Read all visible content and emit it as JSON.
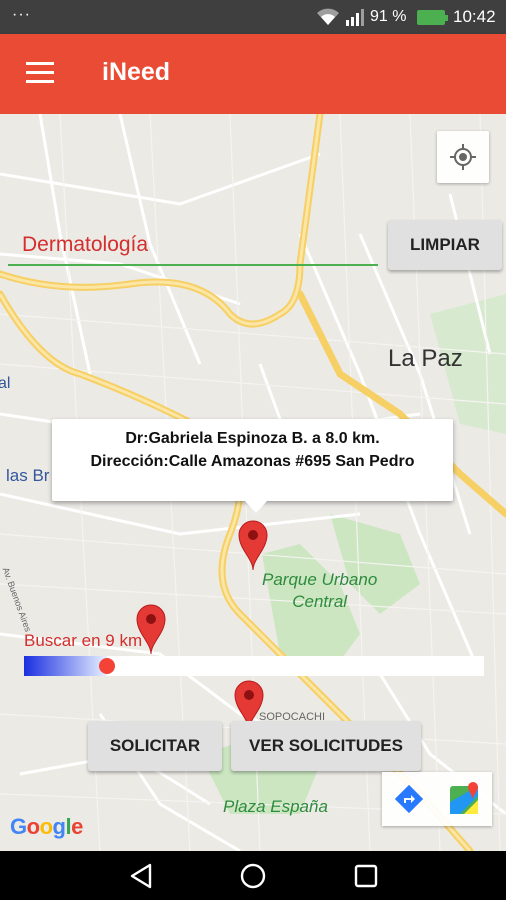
{
  "status_bar": {
    "dots": "···",
    "battery_percent": "91 %",
    "time": "10:42",
    "icons": [
      "wifi-icon",
      "signal-icon",
      "battery-charging-icon"
    ]
  },
  "app_bar": {
    "title": "iNeed",
    "background": "#e94b35",
    "menu_icon": "hamburger-menu-icon"
  },
  "search": {
    "value": "Dermatología",
    "clear_label": "LIMPIAR"
  },
  "map": {
    "labels": {
      "city": "La Paz",
      "park": "Parque Urbano",
      "park_line2": "Central",
      "plaza": "Plaza España",
      "neighborhood": "SOPOCACHI",
      "partial_west": "las Br",
      "partial_transit": "al",
      "street": "Av. Buenos Aires"
    },
    "info_window": {
      "line1": "Dr:Gabriela Espinoza B. a 8.0 km.",
      "line2": "Dirección:Calle Amazonas #695 San Pedro"
    },
    "marker_count": 3,
    "marker_color": "#e53935"
  },
  "radius": {
    "label": "Buscar en 9 km",
    "value_km": 9,
    "fill_fraction": 0.18
  },
  "actions": {
    "request_label": "SOLICITAR",
    "view_requests_label": "VER SOLICITUDES"
  },
  "branding": {
    "google": [
      "G",
      "o",
      "o",
      "g",
      "l",
      "e"
    ]
  },
  "nav_bar": {
    "icons": [
      "back-icon",
      "home-icon",
      "recents-icon"
    ]
  }
}
